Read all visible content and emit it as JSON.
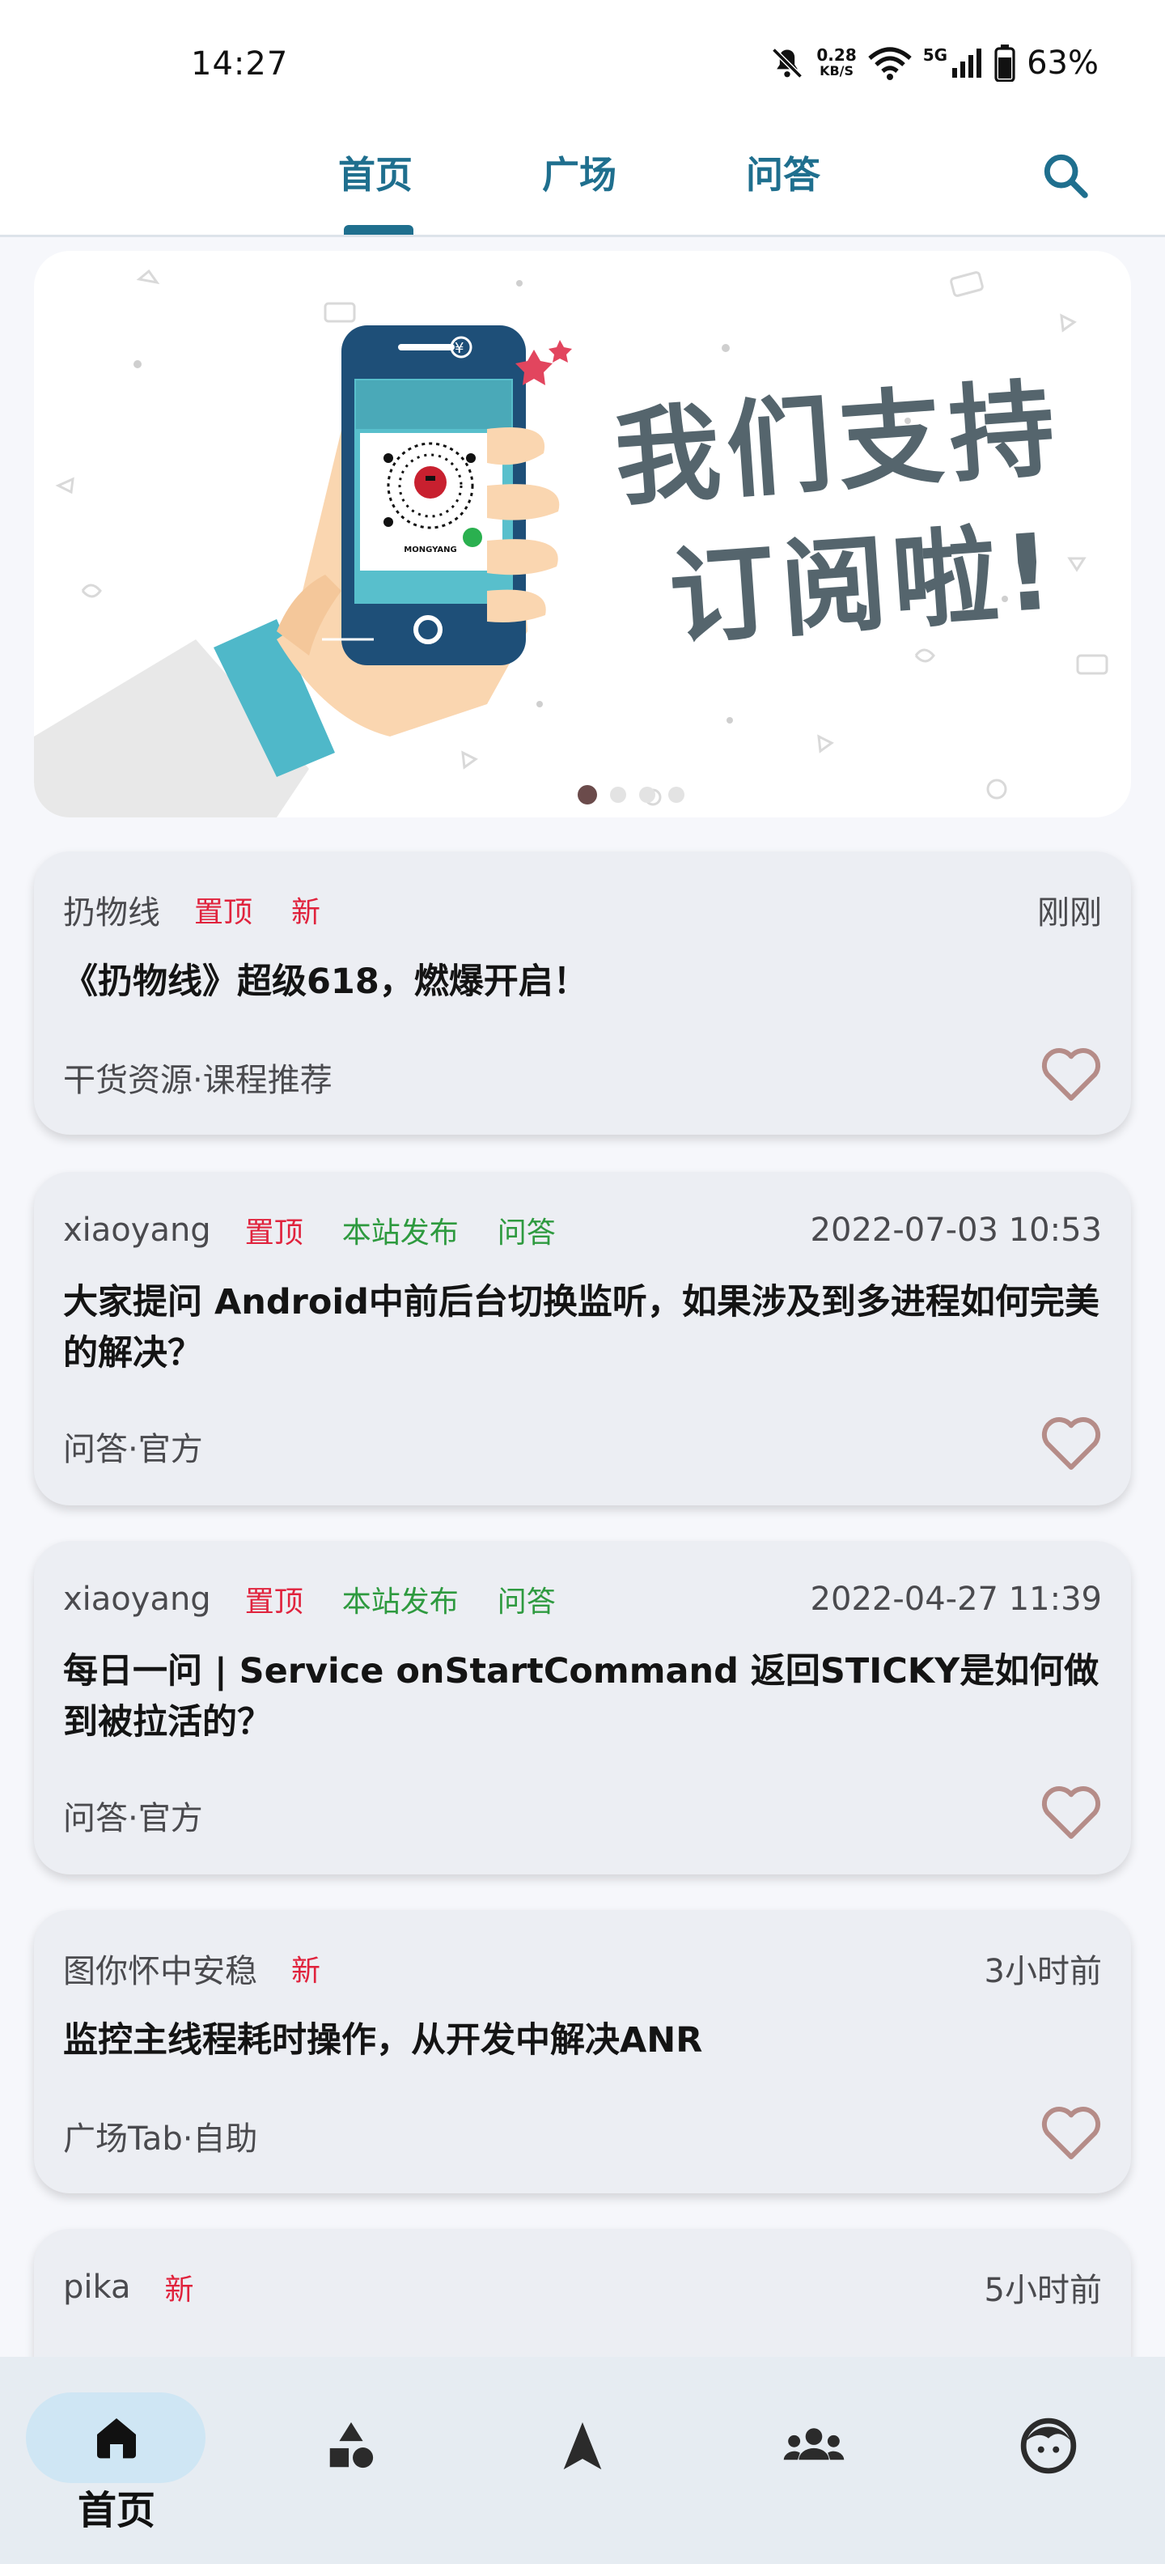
{
  "status_bar": {
    "time": "14:27",
    "net_speed_value": "0.28",
    "net_speed_unit": "KB/S",
    "net_type": "5G",
    "battery": "63%",
    "icons": [
      "mute-bell-icon",
      "wifi-icon",
      "signal-icon",
      "battery-icon"
    ]
  },
  "top_tabs": {
    "items": [
      "首页",
      "广场",
      "问答"
    ],
    "active_index": 0,
    "search_icon": "search-icon"
  },
  "banner": {
    "text_line1": "我们支持",
    "text_line2": "订阅啦!",
    "phone_watermark": "MONGYANG",
    "phone_currency": "¥",
    "slides": 4,
    "active_slide": 0
  },
  "articles": [
    {
      "author": "扔物线",
      "tags": [
        {
          "label": "置顶",
          "color": "red"
        },
        {
          "label": "新",
          "color": "red"
        }
      ],
      "time": "刚刚",
      "title": "《扔物线》超级618，燃爆开启！",
      "category": "干货资源·课程推荐"
    },
    {
      "author": "xiaoyang",
      "tags": [
        {
          "label": "置顶",
          "color": "red"
        },
        {
          "label": "本站发布",
          "color": "green"
        },
        {
          "label": "问答",
          "color": "green"
        }
      ],
      "time": "2022-07-03 10:53",
      "title": "大家提问 Android中前后台切换监听，如果涉及到多进程如何完美的解决？",
      "category": "问答·官方"
    },
    {
      "author": "xiaoyang",
      "tags": [
        {
          "label": "置顶",
          "color": "red"
        },
        {
          "label": "本站发布",
          "color": "green"
        },
        {
          "label": "问答",
          "color": "green"
        }
      ],
      "time": "2022-04-27 11:39",
      "title": "每日一问 | Service onStartCommand 返回STICKY是如何做到被拉活的？",
      "category": "问答·官方"
    },
    {
      "author": "图你怀中安稳",
      "tags": [
        {
          "label": "新",
          "color": "red"
        }
      ],
      "time": "3小时前",
      "title": "监控主线程耗时操作，从开发中解决ANR",
      "category": "广场Tab·自助"
    },
    {
      "author": "pika",
      "tags": [
        {
          "label": "新",
          "color": "red"
        }
      ],
      "time": "5小时前",
      "title": "",
      "category": ""
    }
  ],
  "bottom_nav": {
    "active_label": "首页",
    "items": [
      "home-icon",
      "categories-icon",
      "navigation-icon",
      "people-icon",
      "profile-icon"
    ]
  },
  "colors": {
    "accent": "#1f6f8e",
    "tag_red": "#e0233d",
    "tag_green": "#2e9a3f",
    "card_bg": "#eceef3",
    "nav_pill": "#cfe6f4",
    "heart": "#b58c88"
  }
}
